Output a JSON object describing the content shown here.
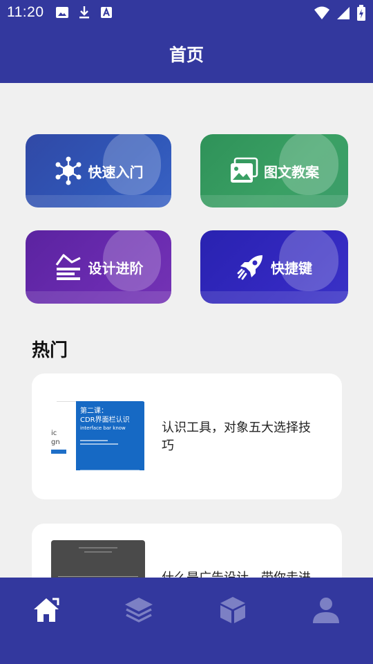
{
  "status_bar": {
    "time": "11:20",
    "icons_left": [
      "image-icon",
      "download-icon",
      "text-a-icon"
    ],
    "icons_right": [
      "wifi-icon",
      "signal-icon",
      "battery-charging-icon"
    ]
  },
  "app_bar": {
    "title": "首页"
  },
  "tiles": [
    {
      "label": "快速入门",
      "icon": "hexagon-network-icon",
      "color": "#2f57b8"
    },
    {
      "label": "图文教案",
      "icon": "gallery-icon",
      "color": "#3aa064"
    },
    {
      "label": "设计进阶",
      "icon": "advance-steps-icon",
      "color": "#6a2bb0"
    },
    {
      "label": "快捷键",
      "icon": "rocket-icon",
      "color": "#3328c0"
    }
  ],
  "hot": {
    "title": "热门",
    "items": [
      {
        "title": "认识工具，对象五大选择技巧",
        "thumb": {
          "side_lines": [
            "ic",
            "gn"
          ],
          "lesson": "第二课：",
          "heading": "CDR界面栏认识",
          "subheading": "interface bar know"
        }
      },
      {
        "title": "什么是广告设计，带你走进",
        "thumb": {}
      }
    ]
  },
  "bottom_nav": [
    {
      "icon": "home-icon",
      "active": true
    },
    {
      "icon": "layers-icon",
      "active": false
    },
    {
      "icon": "cube-icon",
      "active": false
    },
    {
      "icon": "user-icon",
      "active": false
    }
  ]
}
